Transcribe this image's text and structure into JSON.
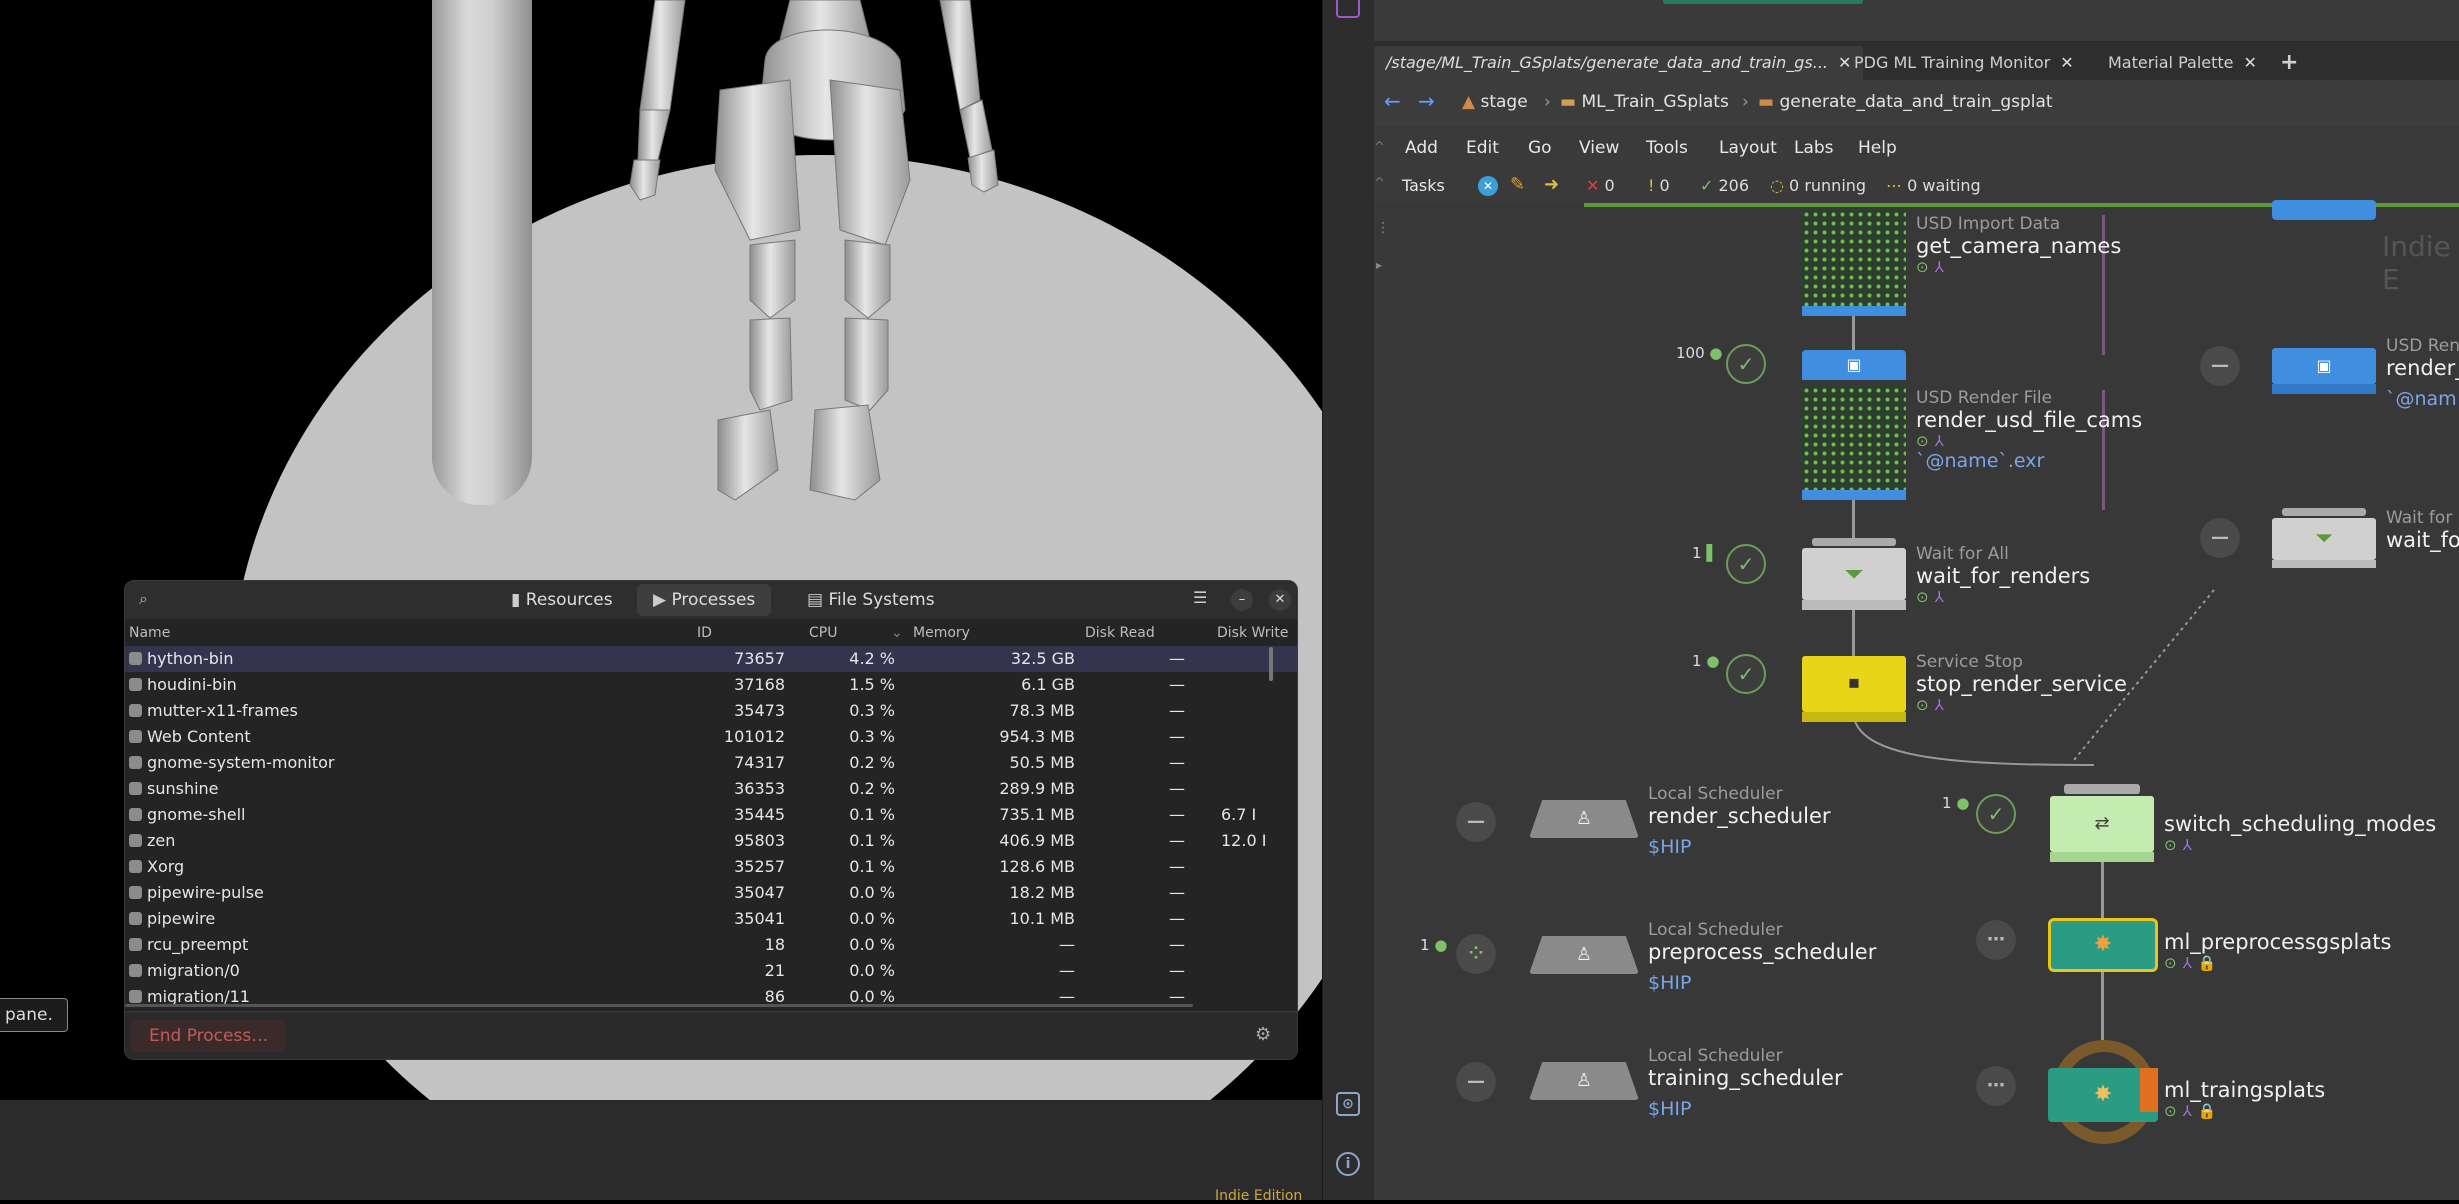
{
  "viewport": {
    "tooltip_text": "pane.",
    "edition_label": "Indie Edition"
  },
  "network": {
    "tabs": [
      {
        "label": "/stage/ML_Train_GSplats/generate_data_and_train_gs..."
      },
      {
        "label": "PDG ML Training Monitor"
      },
      {
        "label": "Material Palette"
      }
    ],
    "breadcrumb": [
      "stage",
      "ML_Train_GSplats",
      "generate_data_and_train_gsplat"
    ],
    "menus": [
      "Add",
      "Edit",
      "Go",
      "View",
      "Tools",
      "Layout",
      "Labs",
      "Help"
    ],
    "tasks": {
      "label": "Tasks",
      "errors": "0",
      "warnings": "0",
      "complete": "206",
      "running": "0 running",
      "waiting": "0 waiting"
    },
    "watermark": "Indie E",
    "nodes": [
      {
        "type": "USD Import Data",
        "name": "get_camera_names"
      },
      {
        "type": "USD Render File",
        "name": "render_usd_file_cams",
        "param": "`@name`.exr",
        "count": "100"
      },
      {
        "type": "Wait for All",
        "name": "wait_for_renders",
        "count": "1"
      },
      {
        "type": "Service Stop",
        "name": "stop_render_service",
        "count": "1"
      },
      {
        "type": "Local Scheduler",
        "name": "render_scheduler",
        "param": "$HIP"
      },
      {
        "type": "Local Scheduler",
        "name": "preprocess_scheduler",
        "param": "$HIP",
        "count": "1"
      },
      {
        "type": "Local Scheduler",
        "name": "training_scheduler",
        "param": "$HIP"
      },
      {
        "name": "switch_scheduling_modes",
        "count": "1"
      },
      {
        "name": "ml_preprocessgsplats"
      },
      {
        "name": "ml_traingsplats"
      },
      {
        "type": "USD Ren",
        "name": "render_",
        "param": "`@nam"
      },
      {
        "type": "Wait for",
        "name": "wait_fo"
      }
    ]
  },
  "sysmon": {
    "tabs": [
      "Resources",
      "Processes",
      "File Systems"
    ],
    "columns": [
      "Name",
      "ID",
      "CPU",
      "Memory",
      "Disk Read",
      "Disk Write"
    ],
    "rows": [
      {
        "name": "hython-bin",
        "id": "73657",
        "cpu": "4.2 %",
        "mem": "32.5 GB",
        "read": "—",
        "write": ""
      },
      {
        "name": "houdini-bin",
        "id": "37168",
        "cpu": "1.5 %",
        "mem": "6.1 GB",
        "read": "—",
        "write": ""
      },
      {
        "name": "mutter-x11-frames",
        "id": "35473",
        "cpu": "0.3 %",
        "mem": "78.3 MB",
        "read": "—",
        "write": ""
      },
      {
        "name": "Web Content",
        "id": "101012",
        "cpu": "0.3 %",
        "mem": "954.3 MB",
        "read": "—",
        "write": ""
      },
      {
        "name": "gnome-system-monitor",
        "id": "74317",
        "cpu": "0.2 %",
        "mem": "50.5 MB",
        "read": "—",
        "write": ""
      },
      {
        "name": "sunshine",
        "id": "36353",
        "cpu": "0.2 %",
        "mem": "289.9 MB",
        "read": "—",
        "write": ""
      },
      {
        "name": "gnome-shell",
        "id": "35445",
        "cpu": "0.1 %",
        "mem": "735.1 MB",
        "read": "—",
        "write": "6.7 I"
      },
      {
        "name": "zen",
        "id": "95803",
        "cpu": "0.1 %",
        "mem": "406.9 MB",
        "read": "—",
        "write": "12.0 I"
      },
      {
        "name": "Xorg",
        "id": "35257",
        "cpu": "0.1 %",
        "mem": "128.6 MB",
        "read": "—",
        "write": ""
      },
      {
        "name": "pipewire-pulse",
        "id": "35047",
        "cpu": "0.0 %",
        "mem": "18.2 MB",
        "read": "—",
        "write": ""
      },
      {
        "name": "pipewire",
        "id": "35041",
        "cpu": "0.0 %",
        "mem": "10.1 MB",
        "read": "—",
        "write": ""
      },
      {
        "name": "rcu_preempt",
        "id": "18",
        "cpu": "0.0 %",
        "mem": "—",
        "read": "—",
        "write": ""
      },
      {
        "name": "migration/0",
        "id": "21",
        "cpu": "0.0 %",
        "mem": "—",
        "read": "—",
        "write": ""
      },
      {
        "name": "migration/11",
        "id": "86",
        "cpu": "0.0 %",
        "mem": "—",
        "read": "—",
        "write": ""
      }
    ],
    "end_process_label": "End Process…"
  },
  "colors": {
    "usd_blue": "#3f8ee0",
    "service_yellow": "#e8d51a",
    "node_grey": "#c8c8c8",
    "teal_node": "#2a9c84",
    "success_green": "#7fc06a",
    "selection": "#34344f",
    "danger": "#c25a5a"
  }
}
